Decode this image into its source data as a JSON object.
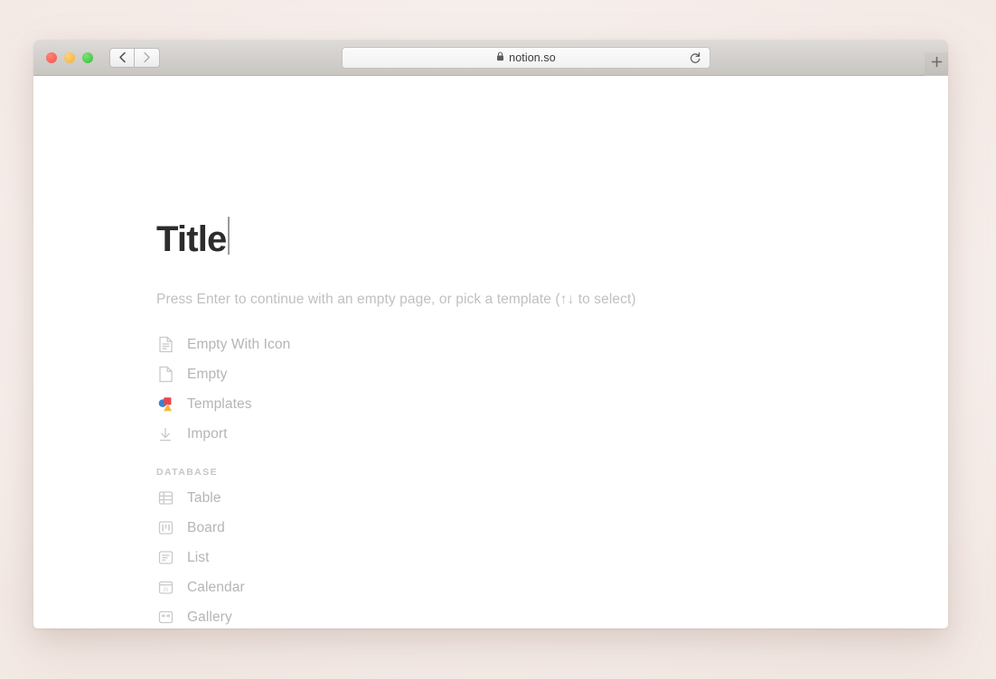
{
  "window": {
    "traffic_lights": [
      "close",
      "minimize",
      "maximize"
    ],
    "back_label": "Back",
    "forward_label": "Forward",
    "url": "notion.so",
    "reload_label": "Reload",
    "new_tab_label": "+"
  },
  "page": {
    "title": "Title",
    "hint": "Press Enter to continue with an empty page, or pick a template (↑↓ to select)",
    "menu_items": [
      {
        "label": "Empty With Icon",
        "icon": "document-lines-icon"
      },
      {
        "label": "Empty",
        "icon": "document-blank-icon"
      },
      {
        "label": "Templates",
        "icon": "templates-shapes-icon"
      },
      {
        "label": "Import",
        "icon": "import-download-icon"
      }
    ],
    "database_section": {
      "header": "DATABASE",
      "items": [
        {
          "label": "Table",
          "icon": "table-grid-icon"
        },
        {
          "label": "Board",
          "icon": "board-kanban-icon"
        },
        {
          "label": "List",
          "icon": "list-lines-icon"
        },
        {
          "label": "Calendar",
          "icon": "calendar-icon",
          "day": "31"
        },
        {
          "label": "Gallery",
          "icon": "gallery-icon"
        }
      ]
    }
  },
  "colors": {
    "backdrop": "#f7efec",
    "page_background": "#ffffff",
    "title_text": "#2c2c2c",
    "muted_text": "#b5b5b5",
    "hint_text": "#c0c0c0",
    "toolbar": "#d3d0cd",
    "templates_blue": "#3b82d6",
    "templates_red": "#e5484d",
    "templates_yellow": "#f5b83d"
  }
}
